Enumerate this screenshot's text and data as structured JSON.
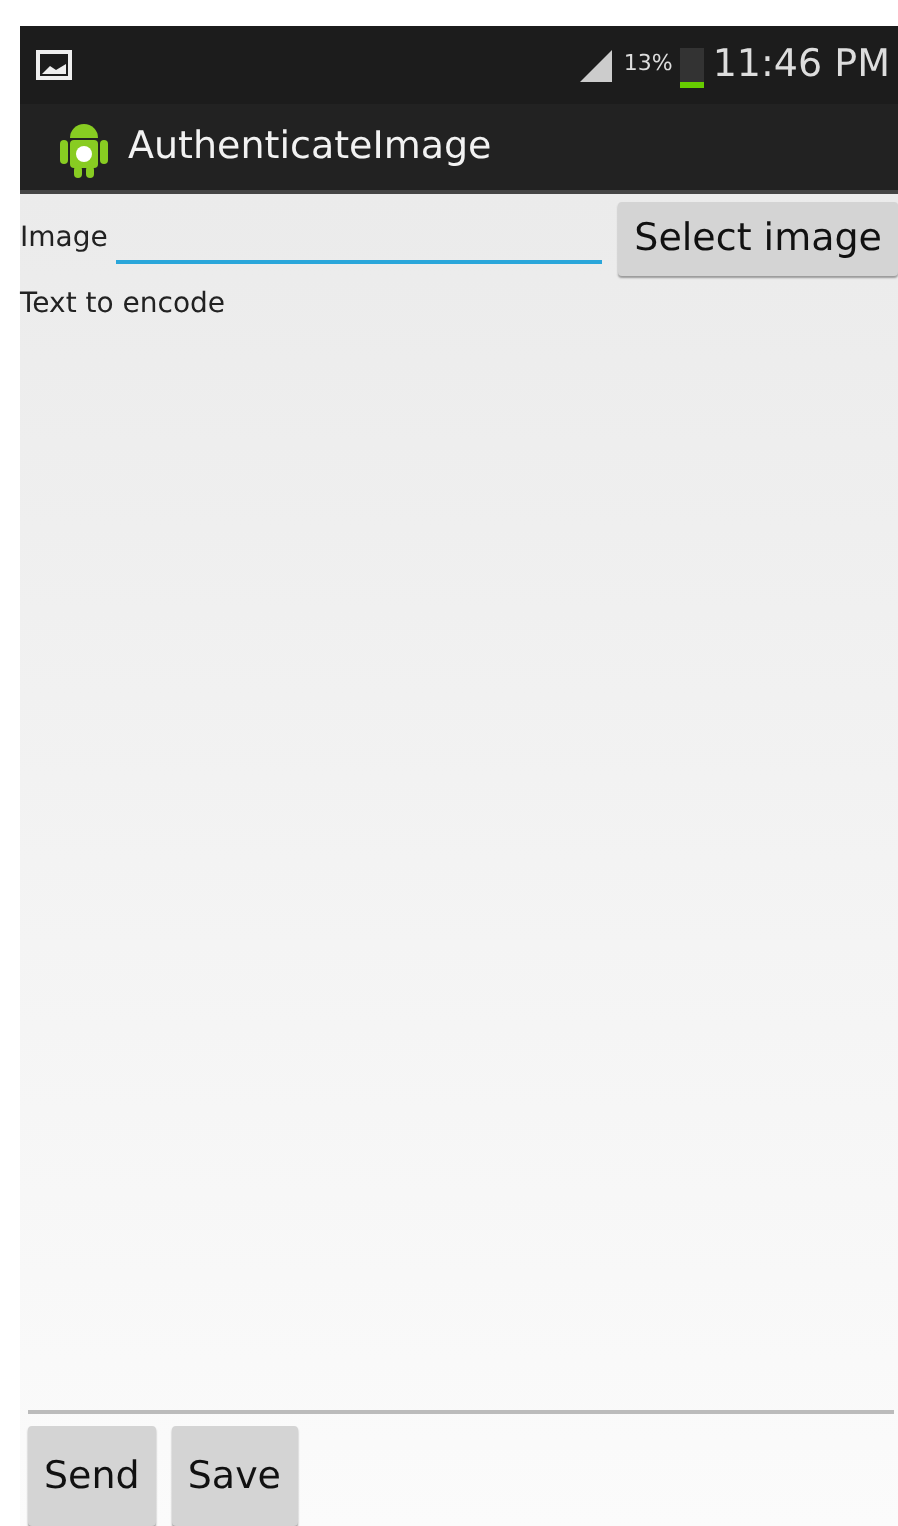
{
  "status_bar": {
    "battery": "13%",
    "time": "11:46 PM"
  },
  "action_bar": {
    "title": "AuthenticateImage"
  },
  "form": {
    "image_label": "Image",
    "image_field": {
      "focused": true
    },
    "select_button": "Select image",
    "text_label": "Text to encode",
    "text_area": {
      "focused": false
    }
  },
  "buttons": [
    "Send",
    "Save"
  ]
}
